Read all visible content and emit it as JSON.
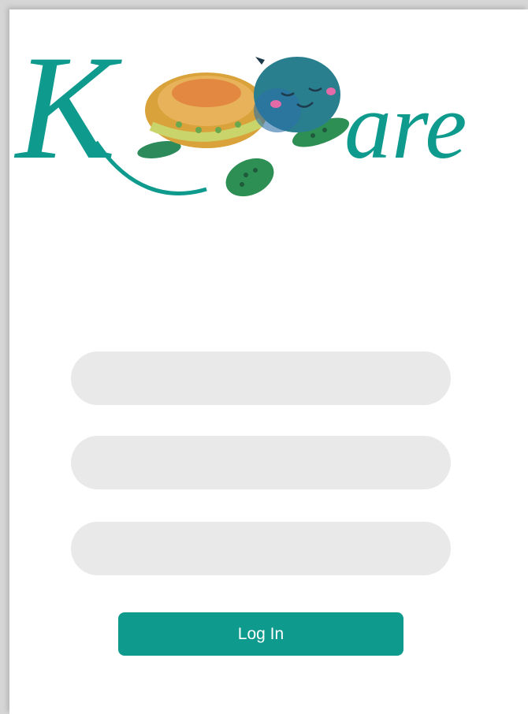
{
  "logo": {
    "letter_k": "K",
    "suffix": "are",
    "brand_color": "#0f9a8e"
  },
  "form": {
    "field_1": {
      "value": "",
      "placeholder": ""
    },
    "field_2": {
      "value": "",
      "placeholder": ""
    },
    "field_3": {
      "value": "",
      "placeholder": ""
    },
    "login_label": "Log In"
  },
  "colors": {
    "accent": "#0f9a8e",
    "field_bg": "#e9e9e9",
    "background": "#ffffff"
  }
}
